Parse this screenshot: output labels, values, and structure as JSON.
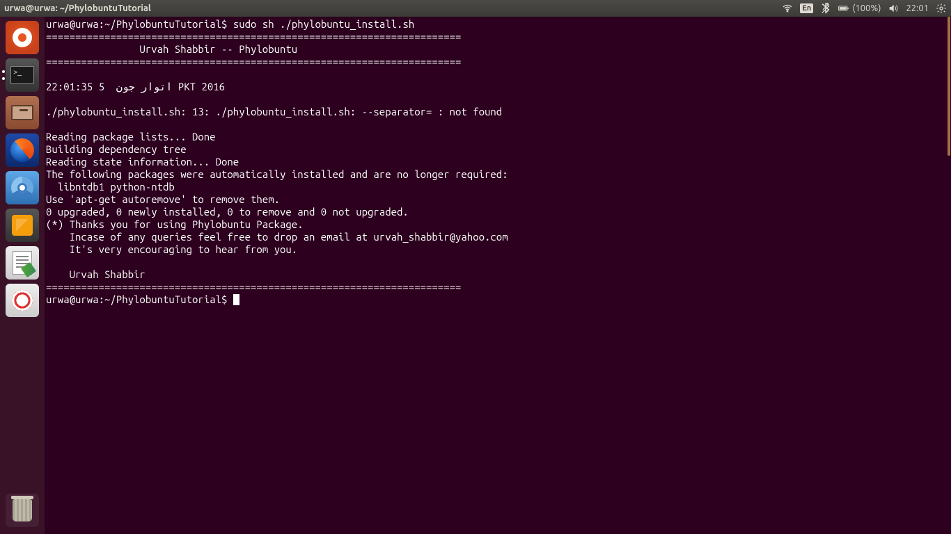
{
  "topbar": {
    "title": "urwa@urwa: ~/PhylobuntuTutorial",
    "lang": "En",
    "battery_pct": "(100%)",
    "time": "22:01"
  },
  "launcher": {
    "items": [
      {
        "name": "dash",
        "label": "Dash"
      },
      {
        "name": "terminal",
        "label": "Terminal"
      },
      {
        "name": "files",
        "label": "Files"
      },
      {
        "name": "firefox",
        "label": "Firefox"
      },
      {
        "name": "chromium",
        "label": "Chromium"
      },
      {
        "name": "sublime",
        "label": "Sublime Text"
      },
      {
        "name": "gedit",
        "label": "Text Editor"
      },
      {
        "name": "evince",
        "label": "Document Viewer"
      },
      {
        "name": "trash",
        "label": "Trash"
      }
    ]
  },
  "terminal": {
    "prompt1_userhost": "urwa@urwa",
    "prompt1_path": "~/PhylobuntuTutorial",
    "command1": "sudo sh ./phylobuntu_install.sh",
    "sep": "=======================================================================",
    "banner_center": "                Urvah Shabbir -- Phylobuntu",
    "dateline": "اتوار جون  5 22:01:35 PKT 2016",
    "errline": "./phylobuntu_install.sh: 13: ./phylobuntu_install.sh: --separator= : not found",
    "l_read": "Reading package lists... Done",
    "l_build": "Building dependency tree",
    "l_state": "Reading state information... Done",
    "l_auto": "The following packages were automatically installed and are no longer required:",
    "l_pkgs": "  libntdb1 python-ntdb",
    "l_remove": "Use 'apt-get autoremove' to remove them.",
    "l_upg": "0 upgraded, 0 newly installed, 0 to remove and 0 not upgraded.",
    "l_thanks": "(*) Thanks you for using Phylobuntu Package.",
    "l_incase": "    Incase of any queries feel free to drop an email at urvah_shabbir@yahoo.com",
    "l_encour": "    It's very encouraging to hear from you.",
    "l_sig": "    Urvah Shabbir",
    "prompt2_userhost": "urwa@urwa",
    "prompt2_path": "~/PhylobuntuTutorial"
  }
}
